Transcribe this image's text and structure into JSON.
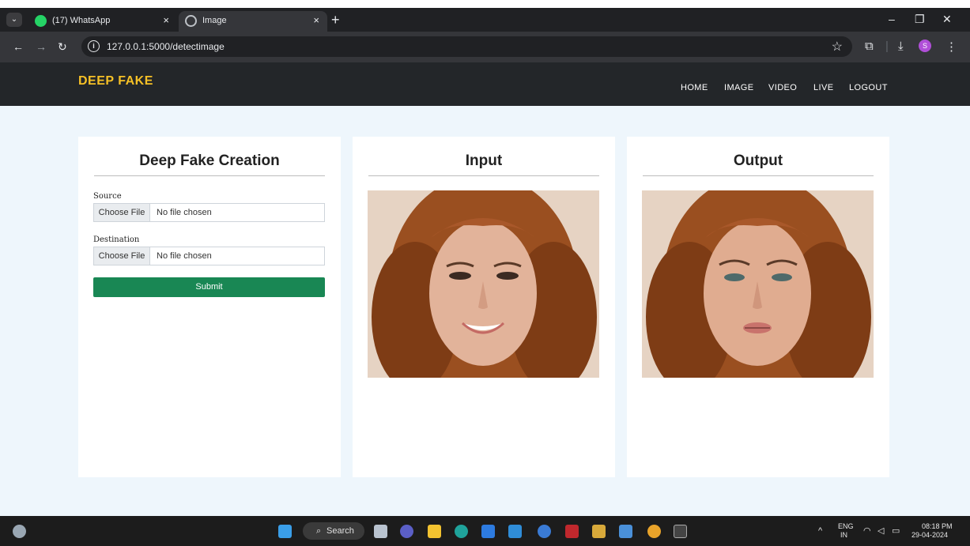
{
  "browser": {
    "tabs": [
      {
        "title": "(17) WhatsApp",
        "active": false,
        "icon": "whatsapp-icon"
      },
      {
        "title": "Image",
        "active": true,
        "icon": "globe-icon"
      }
    ],
    "url": "127.0.0.1:5000/detectimage",
    "profile_initial": "S"
  },
  "site": {
    "brand": "DEEP FAKE",
    "nav": [
      "HOME",
      "IMAGE",
      "VIDEO",
      "LIVE",
      "LOGOUT"
    ]
  },
  "form_card": {
    "title": "Deep Fake Creation",
    "source_label": "Source",
    "destination_label": "Destination",
    "choose_label": "Choose File",
    "file_status": "No file chosen",
    "submit_label": "Submit"
  },
  "input_card": {
    "title": "Input"
  },
  "output_card": {
    "title": "Output"
  },
  "taskbar": {
    "search_label": "Search",
    "lang": "ENG",
    "region": "IN",
    "time": "08:18 PM",
    "date": "29-04-2024"
  },
  "colors": {
    "brand": "#f5c026",
    "submit": "#198754",
    "header_bg": "#232629",
    "main_bg": "#eef6fc"
  }
}
